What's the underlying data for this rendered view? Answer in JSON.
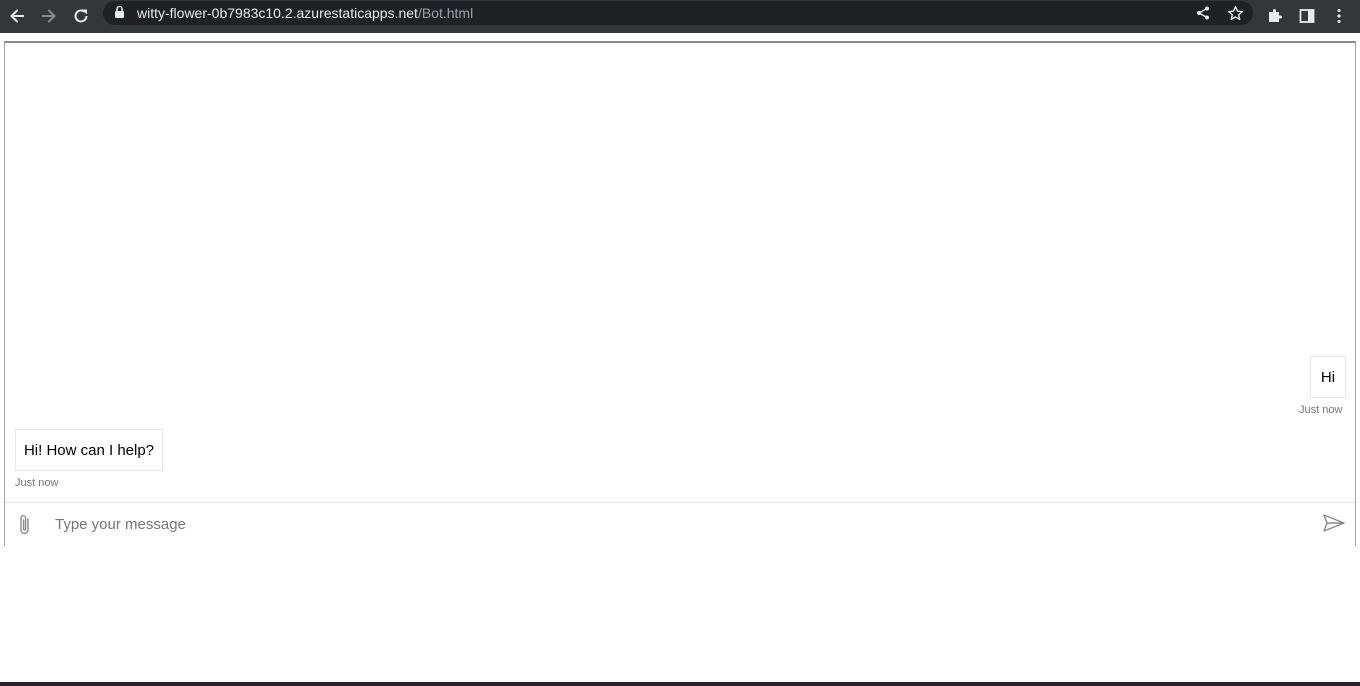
{
  "browser": {
    "url_host": "witty-flower-0b7983c10.2.azurestaticapps.net",
    "url_path": "/Bot.html",
    "icons": [
      "back-icon",
      "forward-icon",
      "reload-icon",
      "lock-icon",
      "share-icon",
      "star-icon",
      "extensions-icon",
      "side-panel-icon",
      "menu-icon"
    ]
  },
  "chat": {
    "messages": [
      {
        "from": "user",
        "text": "Hi",
        "time": "Just now"
      },
      {
        "from": "bot",
        "text": "Hi! How can I help?",
        "time": "Just now"
      }
    ],
    "composer": {
      "placeholder": "Type your message",
      "value": ""
    }
  },
  "colors": {
    "chrome_bar": "#35363a",
    "omnibox": "#202124",
    "bubble_border": "#e6e6e6",
    "timestamp": "#767676"
  }
}
